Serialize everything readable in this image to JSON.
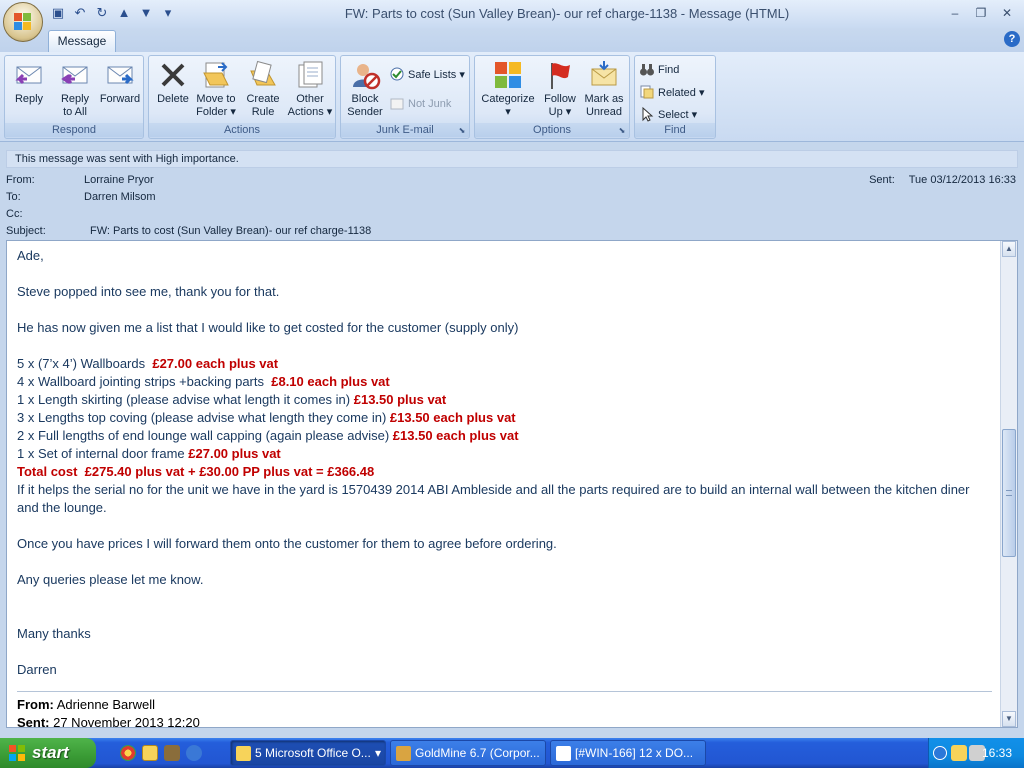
{
  "window": {
    "title": "FW: Parts to cost (Sun Valley Brean)- our ref charge-1138  -  Message (HTML)"
  },
  "tabs": [
    {
      "label": "Message"
    }
  ],
  "ribbon": {
    "groups": [
      {
        "label": "Respond",
        "buttons": [
          {
            "label": "Reply",
            "label2": ""
          },
          {
            "label": "Reply",
            "label2": "to All"
          },
          {
            "label": "Forward",
            "label2": ""
          }
        ]
      },
      {
        "label": "Actions",
        "buttons": [
          {
            "label": "Delete",
            "label2": ""
          },
          {
            "label": "Move to",
            "label2": "Folder ▾"
          },
          {
            "label": "Create",
            "label2": "Rule"
          },
          {
            "label": "Other",
            "label2": "Actions ▾"
          }
        ]
      },
      {
        "label": "Junk E-mail",
        "buttons": [
          {
            "label": "Block",
            "label2": "Sender"
          }
        ],
        "small": [
          {
            "label": "Safe Lists ▾"
          },
          {
            "label": "Not Junk"
          }
        ]
      },
      {
        "label": "Options",
        "buttons": [
          {
            "label": "Categorize",
            "label2": "▾"
          },
          {
            "label": "Follow",
            "label2": "Up ▾"
          },
          {
            "label": "Mark as",
            "label2": "Unread"
          }
        ]
      },
      {
        "label": "Find",
        "small": [
          {
            "label": "Find"
          },
          {
            "label": "Related ▾"
          },
          {
            "label": "Select ▾"
          }
        ]
      }
    ]
  },
  "infobar": "This message was sent with High importance.",
  "header": {
    "from_label": "From:",
    "from": "Lorraine Pryor",
    "to_label": "To:",
    "to": "Darren Milsom",
    "cc_label": "Cc:",
    "cc": "",
    "subject_label": "Subject:",
    "subject": "FW: Parts to cost (Sun Valley Brean)- our ref charge-1138",
    "sent_label": "Sent:",
    "sent": "Tue 03/12/2013 16:33"
  },
  "body": {
    "greeting": "Ade,",
    "line1": "Steve popped into see me, thank you for that.",
    "line2": "He has now given me a list that I would like to get costed for the customer (supply only)",
    "items": [
      {
        "text": "5 x (7’x 4’) Wallboards  ",
        "price": "£27.00 each plus vat"
      },
      {
        "text": "4 x Wallboard jointing strips +backing parts  ",
        "price": "£8.10 each plus vat"
      },
      {
        "text": "1 x Length skirting (please advise what length it comes in) ",
        "price": "£13.50 plus vat"
      },
      {
        "text": "3 x Lengths top coving (please advise what length they come in) ",
        "price": "£13.50 each plus vat"
      },
      {
        "text": "2 x Full lengths of end lounge wall capping (again please advise) ",
        "price": "£13.50 each plus vat"
      },
      {
        "text": "1 x Set of internal door frame ",
        "price": "£27.00 plus vat"
      }
    ],
    "total": "Total cost  £275.40 plus vat + £30.00 PP plus vat = £366.48",
    "line3": "If it helps the serial no for the unit we have in the yard is 1570439 2014 ABI Ambleside and all the parts required are to build an internal wall between the kitchen diner and the lounge.",
    "line4": "Once you have prices I will forward them onto the customer for them to agree before ordering.",
    "line5": "Any queries please let me know.",
    "closing": "Many thanks",
    "signature": "Darren",
    "fwd_from_label": "From:",
    "fwd_from": " Adrienne Barwell",
    "fwd_sent_label": "Sent:",
    "fwd_sent": " 27 November 2013 12:20"
  },
  "taskbar": {
    "start": "start",
    "buttons": [
      {
        "label": "5 Microsoft Office O...",
        "arrow": "▾"
      },
      {
        "label": "GoldMine 6.7 (Corpor..."
      },
      {
        "label": "[#WIN-166] 12 x DO..."
      }
    ],
    "clock": "16:33"
  },
  "colors": {
    "accent": "#c00000",
    "ribbon": "#dde8f7",
    "taskbar": "#245edb"
  }
}
